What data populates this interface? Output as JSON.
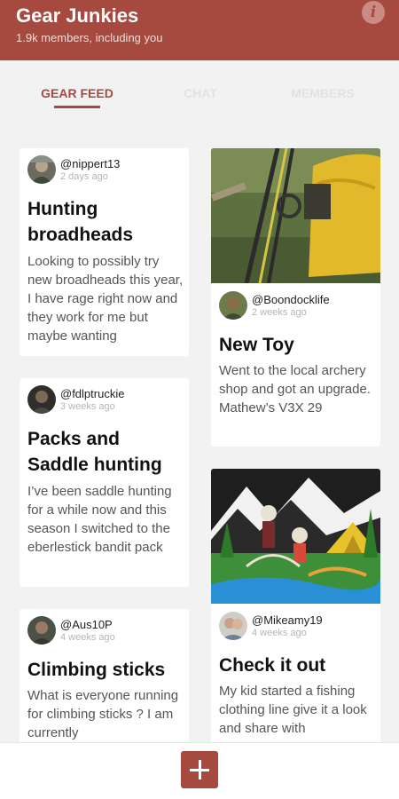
{
  "header": {
    "title": "Gear Junkies",
    "subtitle": "1.9k members, including you",
    "info_glyph": "i"
  },
  "tabs": [
    {
      "label": "GEAR FEED",
      "active": true
    },
    {
      "label": "CHAT",
      "active": false
    },
    {
      "label": "MEMBERS",
      "active": false
    }
  ],
  "posts": [
    {
      "author": "@nippert13",
      "time": "2 days ago",
      "title": "Hunting broadheads",
      "body": "Looking to possibly try new broadheads this year, I have rage right now and they work for me but maybe wanting"
    },
    {
      "author": "@Boondocklife",
      "time": "2 weeks ago",
      "title": "New Toy",
      "body": "Went to the local archery shop and got an upgrade. Mathew’s V3X 29",
      "image": "compound-bow-photo"
    },
    {
      "author": "@fdlptruckie",
      "time": "3 weeks ago",
      "title": "Packs and Saddle hunting",
      "body": "I’ve been saddle hunting for a while now and this season I switched to the eberlestick bandit pack"
    },
    {
      "author": "@Mikeamy19",
      "time": "4 weeks ago",
      "title": "Check it out",
      "body": "My kid started a fishing clothing line give it a look and share with",
      "image": "fishing-skeleton-artwork"
    },
    {
      "author": "@Aus10P",
      "time": "4 weeks ago",
      "title": "Climbing sticks",
      "body": "What is everyone running for climbing sticks ? I am currently"
    }
  ],
  "colors": {
    "brand": "#a64a40",
    "tab_inactive": "#e2e2e2",
    "background": "#f2f2f2"
  },
  "fab": {
    "icon": "plus-icon"
  }
}
